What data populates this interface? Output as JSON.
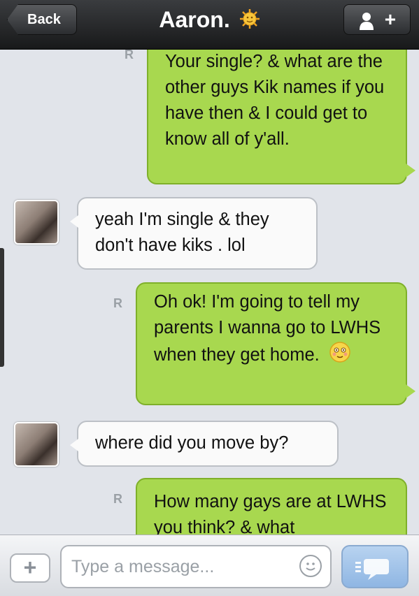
{
  "header": {
    "back_label": "Back",
    "title": "Aaron.",
    "title_icon": "sun-emoji-icon",
    "add_contact_icon": "add-person-icon",
    "add_contact_label": "+"
  },
  "messages": [
    {
      "dir": "out",
      "receipt": "R",
      "text": "Your single? & what are the other guys Kik names if you have then & I could get to know all of y'all."
    },
    {
      "dir": "in",
      "text": "yeah I'm single & they don't have kiks . lol"
    },
    {
      "dir": "out",
      "receipt": "R",
      "text": "Oh ok! I'm going to tell my parents I wanna go to LWHS when they get home.",
      "emoji": "flushed-smile-emoji-icon"
    },
    {
      "dir": "in",
      "text": "where did you move by?"
    },
    {
      "dir": "out",
      "receipt": "R",
      "text": "How many gays are at LWHS you think? & what"
    }
  ],
  "composer": {
    "attach_label": "+",
    "placeholder": "Type a message...",
    "emoji_icon": "smiley-icon",
    "send_icon": "send-icon"
  },
  "colors": {
    "outgoing_bubble": "#a8d84f",
    "incoming_bubble": "#fafafa",
    "header_bg": "#1f2022",
    "send_button": "#9ec2ea"
  }
}
